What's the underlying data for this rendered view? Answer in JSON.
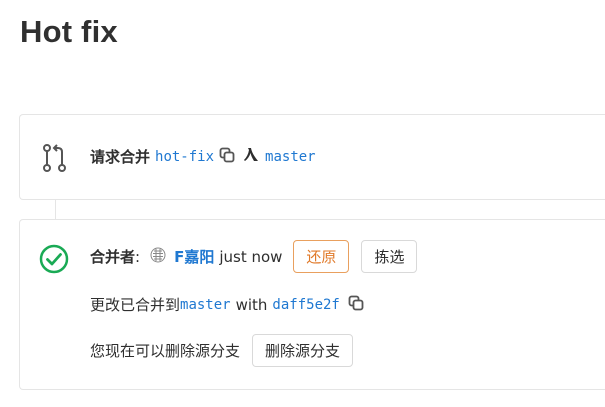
{
  "page": {
    "title": "Hot fix"
  },
  "merge_request": {
    "label": "请求合并",
    "source_branch": "hot-fix",
    "target_branch": "master",
    "icons": {
      "mr": "merge-request-icon",
      "copy": "copy-icon",
      "into": "arrow-into-icon"
    }
  },
  "merged": {
    "label": "合并者",
    "colon": ":",
    "user": "F嘉阳",
    "time": "just now",
    "revert_button": "还原",
    "cherry_pick_button": "拣选",
    "changes_text": "更改已合并到",
    "target_branch": "master",
    "with_text": "with",
    "commit_sha": "daff5e2f",
    "delete_hint": "您现在可以删除源分支",
    "delete_button": "删除源分支",
    "colors": {
      "success": "#1aaa55",
      "link": "#1f78d1",
      "warning": "#e07a2a"
    }
  }
}
